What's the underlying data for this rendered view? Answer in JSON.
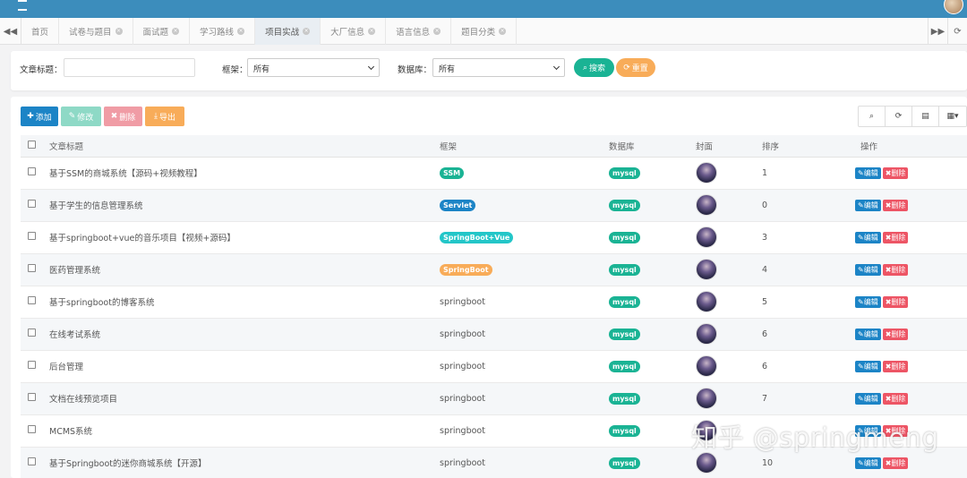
{
  "header": {
    "menu_icon": "hamburger-icon",
    "user_avatar": "avatar"
  },
  "tabs": [
    {
      "label": "首页",
      "closable": false,
      "active": false
    },
    {
      "label": "试卷与题目",
      "closable": true,
      "active": false
    },
    {
      "label": "面试题",
      "closable": true,
      "active": false
    },
    {
      "label": "学习路线",
      "closable": true,
      "active": false
    },
    {
      "label": "项目实战",
      "closable": true,
      "active": true
    },
    {
      "label": "大厂信息",
      "closable": true,
      "active": false
    },
    {
      "label": "语言信息",
      "closable": true,
      "active": false
    },
    {
      "label": "题目分类",
      "closable": true,
      "active": false
    }
  ],
  "search": {
    "title_label": "文章标题：",
    "title_value": "",
    "framework_label": "框架：",
    "framework_value": "所有",
    "database_label": "数据库：",
    "database_value": "所有",
    "search_button": "搜索",
    "reset_button": "重置"
  },
  "toolbar": {
    "add": "添加",
    "edit": "修改",
    "delete": "删除",
    "export": "导出"
  },
  "table": {
    "headers": {
      "title": "文章标题",
      "framework": "框架",
      "database": "数据库",
      "cover": "封面",
      "order": "排序",
      "actions": "操作"
    },
    "edit_label": "编辑",
    "delete_label": "删除",
    "rows": [
      {
        "title": "基于SSM的商城系统【源码+视频教程】",
        "framework": "SSM",
        "framework_style": "badge-green",
        "database": "mysql",
        "order": "1"
      },
      {
        "title": "基于学生的信息管理系统",
        "framework": "Servlet",
        "framework_style": "badge-blue",
        "database": "mysql",
        "order": "0"
      },
      {
        "title": "基于springboot+vue的音乐项目【视频+源码】",
        "framework": "SpringBoot+Vue",
        "framework_style": "badge-cyan",
        "database": "mysql",
        "order": "3"
      },
      {
        "title": "医药管理系统",
        "framework": "SpringBoot",
        "framework_style": "badge-orange",
        "database": "mysql",
        "order": "4"
      },
      {
        "title": "基于springboot的博客系统",
        "framework": "springboot",
        "framework_style": "plain",
        "database": "mysql",
        "order": "5"
      },
      {
        "title": "在线考试系统",
        "framework": "springboot",
        "framework_style": "plain",
        "database": "mysql",
        "order": "6"
      },
      {
        "title": "后台管理",
        "framework": "springboot",
        "framework_style": "plain",
        "database": "mysql",
        "order": "6"
      },
      {
        "title": "文档在线预览项目",
        "framework": "springboot",
        "framework_style": "plain",
        "database": "mysql",
        "order": "7"
      },
      {
        "title": "MCMS系统",
        "framework": "springboot",
        "framework_style": "plain",
        "database": "mysql",
        "order": ""
      },
      {
        "title": "基于Springboot的迷你商城系统【开源】",
        "framework": "springboot",
        "framework_style": "plain",
        "database": "mysql",
        "order": "10"
      }
    ]
  },
  "watermark": "知乎 @springmeng",
  "colors": {
    "header": "#3c8dbc",
    "primary": "#1c84c6",
    "success": "#1ab394",
    "warning": "#f8ac59",
    "danger": "#ed5565",
    "info": "#23c6c8"
  }
}
